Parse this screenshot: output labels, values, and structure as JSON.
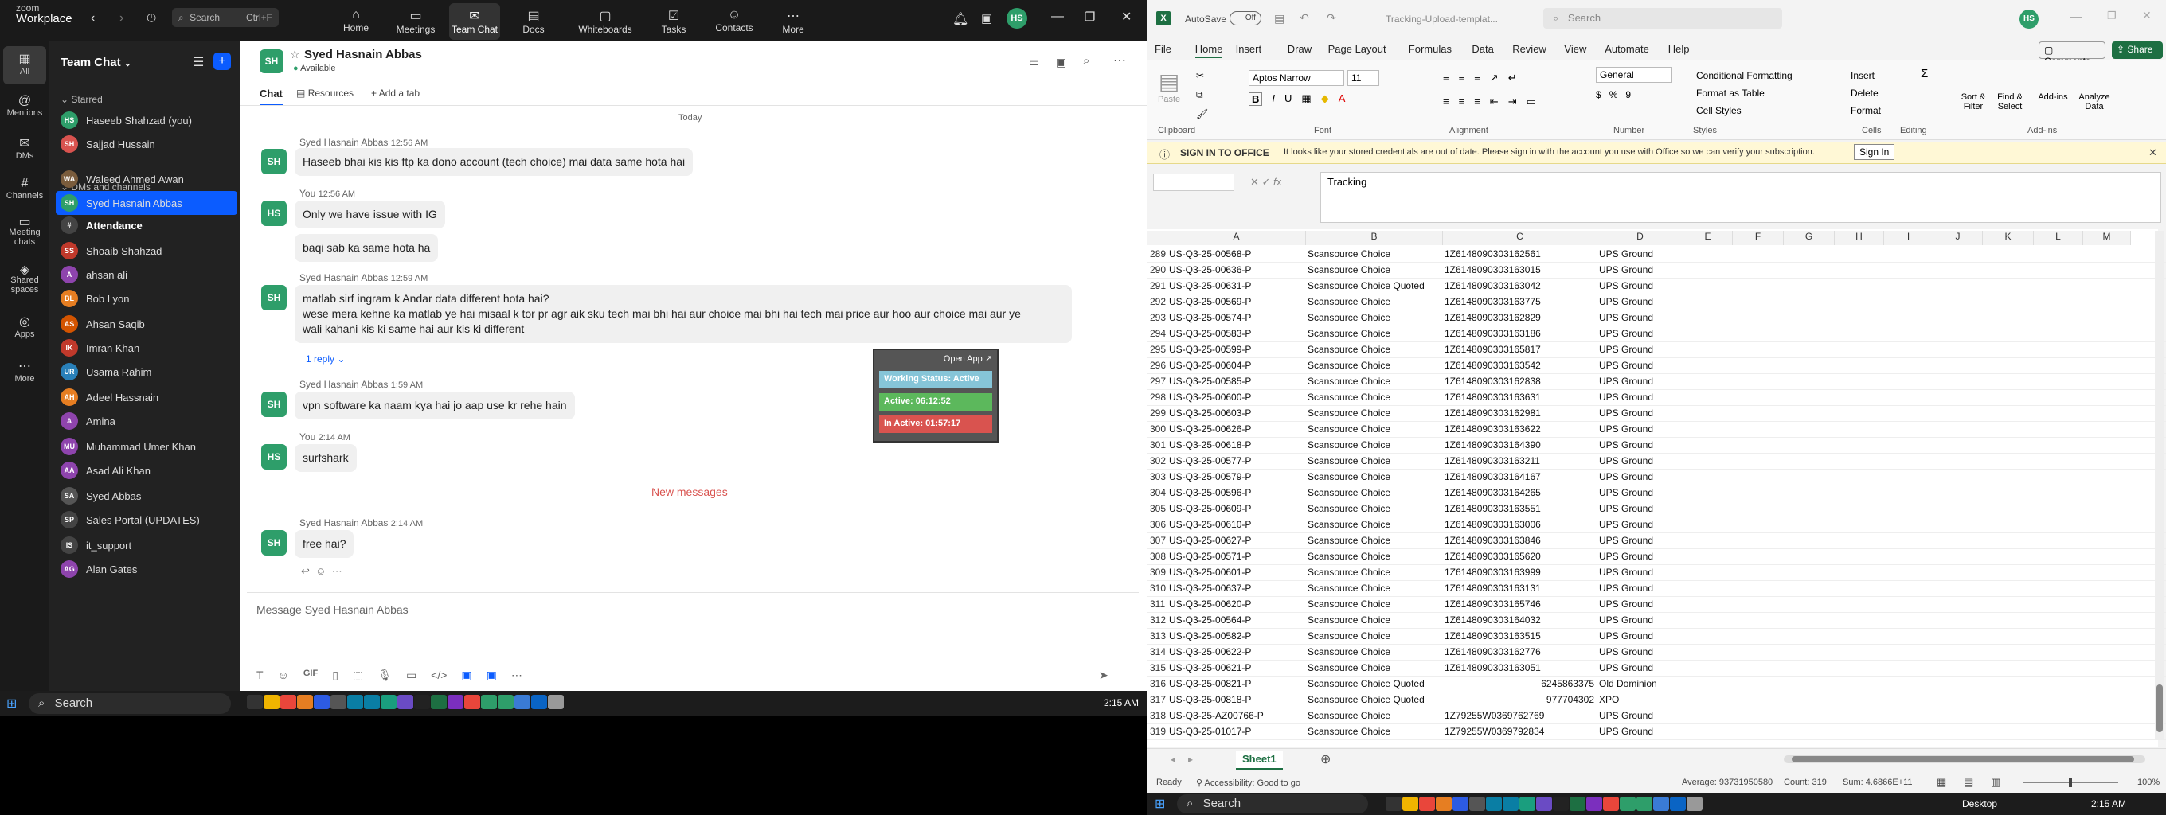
{
  "zoom": {
    "brand_line1": "zoom",
    "brand_line2": "Workplace",
    "search_placeholder": "Search",
    "search_shortcut": "Ctrl+F",
    "tabs": [
      {
        "label": "Home",
        "icon": "home-icon"
      },
      {
        "label": "Meetings",
        "icon": "video-icon"
      },
      {
        "label": "Team Chat",
        "icon": "chat-icon"
      },
      {
        "label": "Docs",
        "icon": "doc-icon"
      },
      {
        "label": "Whiteboards",
        "icon": "whiteboard-icon"
      },
      {
        "label": "Tasks",
        "icon": "tasks-icon"
      },
      {
        "label": "Contacts",
        "icon": "contacts-icon"
      },
      {
        "label": "More",
        "icon": "more-icon"
      }
    ],
    "avatar_initials": "HS",
    "rail": [
      {
        "label": "All"
      },
      {
        "label": "Mentions"
      },
      {
        "label": "DMs"
      },
      {
        "label": "Channels"
      },
      {
        "label": "Meeting chats"
      },
      {
        "label": "Shared spaces"
      },
      {
        "label": "Apps"
      },
      {
        "label": "More"
      }
    ],
    "sidebar": {
      "title": "Team Chat",
      "starred_label": "Starred",
      "dms_label": "DMs and channels",
      "items": [
        {
          "initials": "HS",
          "name": "Haseeb Shahzad (you)",
          "color": "#2e9e6a"
        },
        {
          "initials": "SH",
          "name": "Sajjad Hussain",
          "color": "#d9534f"
        },
        {
          "initials": "WA",
          "name": "Waleed Ahmed Awan",
          "color": "#7a5c3c"
        },
        {
          "initials": "SH",
          "name": "Syed Hasnain Abbas",
          "color": "#2e9e6a"
        },
        {
          "initials": "#",
          "name": "Attendance",
          "color": "#444"
        },
        {
          "initials": "SS",
          "name": "Shoaib Shahzad",
          "color": "#c0392b"
        },
        {
          "initials": "A",
          "name": "ahsan ali",
          "color": "#8e44ad"
        },
        {
          "initials": "BL",
          "name": "Bob Lyon",
          "color": "#e67e22"
        },
        {
          "initials": "AS",
          "name": "Ahsan Saqib",
          "color": "#d35400"
        },
        {
          "initials": "IK",
          "name": "Imran Khan",
          "color": "#c0392b"
        },
        {
          "initials": "UR",
          "name": "Usama Rahim",
          "color": "#2980b9"
        },
        {
          "initials": "AH",
          "name": "Adeel Hassnain",
          "color": "#e67e22"
        },
        {
          "initials": "A",
          "name": "Amina",
          "color": "#8e44ad"
        },
        {
          "initials": "MU",
          "name": "Muhammad Umer Khan",
          "color": "#8e44ad"
        },
        {
          "initials": "AA",
          "name": "Asad Ali Khan",
          "color": "#8e44ad"
        },
        {
          "initials": "SA",
          "name": "Syed Abbas",
          "color": "#555"
        },
        {
          "initials": "SP",
          "name": "Sales Portal (UPDATES)",
          "color": "#444"
        },
        {
          "initials": "IS",
          "name": "it_support",
          "color": "#444"
        },
        {
          "initials": "AG",
          "name": "Alan Gates",
          "color": "#8e44ad"
        }
      ]
    },
    "chat": {
      "contact_initials": "SH",
      "contact_name": "Syed Hasnain Abbas",
      "status": "Available",
      "tab_chat": "Chat",
      "tab_resources": "Resources",
      "tab_add": "Add a tab",
      "date_divider": "Today",
      "messages": [
        {
          "sender": "Syed Hasnain Abbas",
          "time": "12:56 AM",
          "text": "Haseeb bhai kis kis ftp ka dono account (tech choice) mai data same hota hai"
        },
        {
          "sender": "You",
          "time": "12:56 AM",
          "text": "Only we have issue with IG"
        },
        {
          "sender": "",
          "time": "",
          "text": "baqi sab ka same hota ha"
        },
        {
          "sender": "Syed Hasnain Abbas",
          "time": "12:59 AM",
          "text": "matlab sirf ingram k Andar data different hota hai?"
        },
        {
          "sender": "",
          "time": "",
          "text": "wese mera kehne ka matlab ye hai misaal k tor pr agr aik sku tech mai bhi hai aur choice mai bhi hai tech mai price aur hoo aur choice mai aur ye"
        },
        {
          "sender": "",
          "time": "",
          "text": "wali kahani kis ki same hai aur kis ki different"
        },
        {
          "sender": "Syed Hasnain Abbas",
          "time": "1:59 AM",
          "text": "vpn software ka naam kya hai jo aap use kr rehe hain"
        },
        {
          "sender": "You",
          "time": "2:14 AM",
          "text": "surfshark"
        },
        {
          "sender": "Syed Hasnain Abbas",
          "time": "2:14 AM",
          "text": "free hai?"
        }
      ],
      "reply_label": "1 reply",
      "new_messages": "New messages",
      "input_placeholder": "Message Syed Hasnain Abbas"
    },
    "widget": {
      "open_app": "Open App ↗",
      "working_status": "Working Status: Active",
      "active": "Active: 06:12:52",
      "inactive": "In Active: 01:57:17"
    }
  },
  "excel": {
    "autosave_label": "AutoSave",
    "autosave_state": "Off",
    "file_title": "Tracking-Upload-templat...",
    "search_placeholder": "Search",
    "user_initials": "HS",
    "menu": [
      "File",
      "Home",
      "Insert",
      "Draw",
      "Page Layout",
      "Formulas",
      "Data",
      "Review",
      "View",
      "Automate",
      "Help"
    ],
    "comments_label": "Comments",
    "share_label": "Share",
    "font_name": "Aptos Narrow",
    "font_size": "11",
    "number_format": "General",
    "groups": [
      "Clipboard",
      "Font",
      "Alignment",
      "Number",
      "Styles",
      "Cells",
      "Editing",
      "Add-ins"
    ],
    "ribbon_labels": {
      "paste": "Paste",
      "cond_format": "Conditional Formatting",
      "format_table": "Format as Table",
      "cell_styles": "Cell Styles",
      "insert": "Insert",
      "delete": "Delete",
      "format": "Format",
      "sort_filter": "Sort & Filter",
      "find_select": "Find & Select",
      "addins": "Add-ins",
      "analyze": "Analyze Data"
    },
    "notice_title": "SIGN IN TO OFFICE",
    "notice_text": "It looks like your stored credentials are out of date. Please sign in with the account you use with Office so we can verify your subscription.",
    "sign_in_label": "Sign In",
    "formula_value": "Tracking",
    "columns": [
      "A",
      "B",
      "C",
      "D",
      "E",
      "F",
      "G",
      "H",
      "I",
      "J",
      "K",
      "L",
      "M"
    ],
    "rows": [
      {
        "n": "289",
        "a": "US-Q3-25-00568-P",
        "b": "Scansource Choice",
        "c": "1Z6148090303162561",
        "d": "UPS Ground"
      },
      {
        "n": "290",
        "a": "US-Q3-25-00636-P",
        "b": "Scansource Choice",
        "c": "1Z6148090303163015",
        "d": "UPS Ground"
      },
      {
        "n": "291",
        "a": "US-Q3-25-00631-P",
        "b": "Scansource Choice Quoted",
        "c": "1Z6148090303163042",
        "d": "UPS Ground"
      },
      {
        "n": "292",
        "a": "US-Q3-25-00569-P",
        "b": "Scansource Choice",
        "c": "1Z6148090303163775",
        "d": "UPS Ground"
      },
      {
        "n": "293",
        "a": "US-Q3-25-00574-P",
        "b": "Scansource Choice",
        "c": "1Z6148090303162829",
        "d": "UPS Ground"
      },
      {
        "n": "294",
        "a": "US-Q3-25-00583-P",
        "b": "Scansource Choice",
        "c": "1Z6148090303163186",
        "d": "UPS Ground"
      },
      {
        "n": "295",
        "a": "US-Q3-25-00599-P",
        "b": "Scansource Choice",
        "c": "1Z6148090303165817",
        "d": "UPS Ground"
      },
      {
        "n": "296",
        "a": "US-Q3-25-00604-P",
        "b": "Scansource Choice",
        "c": "1Z6148090303163542",
        "d": "UPS Ground"
      },
      {
        "n": "297",
        "a": "US-Q3-25-00585-P",
        "b": "Scansource Choice",
        "c": "1Z6148090303162838",
        "d": "UPS Ground"
      },
      {
        "n": "298",
        "a": "US-Q3-25-00600-P",
        "b": "Scansource Choice",
        "c": "1Z6148090303163631",
        "d": "UPS Ground"
      },
      {
        "n": "299",
        "a": "US-Q3-25-00603-P",
        "b": "Scansource Choice",
        "c": "1Z6148090303162981",
        "d": "UPS Ground"
      },
      {
        "n": "300",
        "a": "US-Q3-25-00626-P",
        "b": "Scansource Choice",
        "c": "1Z6148090303163622",
        "d": "UPS Ground"
      },
      {
        "n": "301",
        "a": "US-Q3-25-00618-P",
        "b": "Scansource Choice",
        "c": "1Z6148090303164390",
        "d": "UPS Ground"
      },
      {
        "n": "302",
        "a": "US-Q3-25-00577-P",
        "b": "Scansource Choice",
        "c": "1Z6148090303163211",
        "d": "UPS Ground"
      },
      {
        "n": "303",
        "a": "US-Q3-25-00579-P",
        "b": "Scansource Choice",
        "c": "1Z6148090303164167",
        "d": "UPS Ground"
      },
      {
        "n": "304",
        "a": "US-Q3-25-00596-P",
        "b": "Scansource Choice",
        "c": "1Z6148090303164265",
        "d": "UPS Ground"
      },
      {
        "n": "305",
        "a": "US-Q3-25-00609-P",
        "b": "Scansource Choice",
        "c": "1Z6148090303163551",
        "d": "UPS Ground"
      },
      {
        "n": "306",
        "a": "US-Q3-25-00610-P",
        "b": "Scansource Choice",
        "c": "1Z6148090303163006",
        "d": "UPS Ground"
      },
      {
        "n": "307",
        "a": "US-Q3-25-00627-P",
        "b": "Scansource Choice",
        "c": "1Z6148090303163846",
        "d": "UPS Ground"
      },
      {
        "n": "308",
        "a": "US-Q3-25-00571-P",
        "b": "Scansource Choice",
        "c": "1Z6148090303165620",
        "d": "UPS Ground"
      },
      {
        "n": "309",
        "a": "US-Q3-25-00601-P",
        "b": "Scansource Choice",
        "c": "1Z6148090303163999",
        "d": "UPS Ground"
      },
      {
        "n": "310",
        "a": "US-Q3-25-00637-P",
        "b": "Scansource Choice",
        "c": "1Z6148090303163131",
        "d": "UPS Ground"
      },
      {
        "n": "311",
        "a": "US-Q3-25-00620-P",
        "b": "Scansource Choice",
        "c": "1Z6148090303165746",
        "d": "UPS Ground"
      },
      {
        "n": "312",
        "a": "US-Q3-25-00564-P",
        "b": "Scansource Choice",
        "c": "1Z6148090303164032",
        "d": "UPS Ground"
      },
      {
        "n": "313",
        "a": "US-Q3-25-00582-P",
        "b": "Scansource Choice",
        "c": "1Z6148090303163515",
        "d": "UPS Ground"
      },
      {
        "n": "314",
        "a": "US-Q3-25-00622-P",
        "b": "Scansource Choice",
        "c": "1Z6148090303162776",
        "d": "UPS Ground"
      },
      {
        "n": "315",
        "a": "US-Q3-25-00621-P",
        "b": "Scansource Choice",
        "c": "1Z6148090303163051",
        "d": "UPS Ground"
      },
      {
        "n": "316",
        "a": "US-Q3-25-00821-P",
        "b": "Scansource Choice Quoted",
        "c": "6245863375",
        "d": "Old Dominion"
      },
      {
        "n": "317",
        "a": "US-Q3-25-00818-P",
        "b": "Scansource Choice Quoted",
        "c": "977704302",
        "d": "XPO"
      },
      {
        "n": "318",
        "a": "US-Q3-25-AZ00766-P",
        "b": "Scansource Choice",
        "c": "1Z79255W0369762769",
        "d": "UPS Ground"
      },
      {
        "n": "319",
        "a": "US-Q3-25-01017-P",
        "b": "Scansource Choice",
        "c": "1Z79255W0369792834",
        "d": "UPS Ground"
      }
    ],
    "sheet_tab": "Sheet1",
    "status_ready": "Ready",
    "accessibility": "Accessibility: Good to go",
    "average": "Average: 93731950580",
    "count": "Count: 319",
    "sum": "Sum: 4.6866E+11",
    "zoom": "100%"
  },
  "taskbar_left": {
    "search": "Search",
    "time": "2:15 AM"
  },
  "taskbar_right": {
    "search": "Search",
    "desktop": "Desktop",
    "time": "2:15 AM"
  }
}
